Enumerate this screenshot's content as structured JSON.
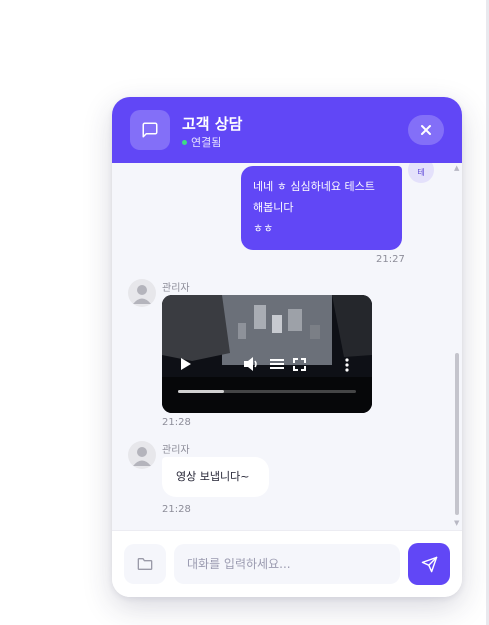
{
  "header": {
    "title": "고객 상담",
    "status": "연결됨",
    "status_color": "#3ddc84",
    "chat_icon": "chat-bubble-icon",
    "close_icon": "close-icon"
  },
  "colors": {
    "accent": "#6147f6",
    "chat_background": "#f5f6fb"
  },
  "messages": [
    {
      "sender": "user",
      "avatar_text": "테",
      "lines": [
        "네네 ㅎ 심심하네요 테스트",
        "해봅니다",
        "ㅎㅎ"
      ],
      "time": "21:27"
    },
    {
      "sender": "admin",
      "name": "관리자",
      "type": "video",
      "time": "21:28",
      "video": {
        "progress": 0.26,
        "controls": [
          "play-icon",
          "volume-icon",
          "captions-icon",
          "fullscreen-icon",
          "more-options-icon"
        ]
      }
    },
    {
      "sender": "admin",
      "name": "관리자",
      "text": "영상 보냅니다~",
      "time": "21:28"
    }
  ],
  "footer": {
    "input_placeholder": "대화를 입력하세요...",
    "input_value": "",
    "attach_icon": "folder-icon",
    "send_icon": "send-icon"
  }
}
